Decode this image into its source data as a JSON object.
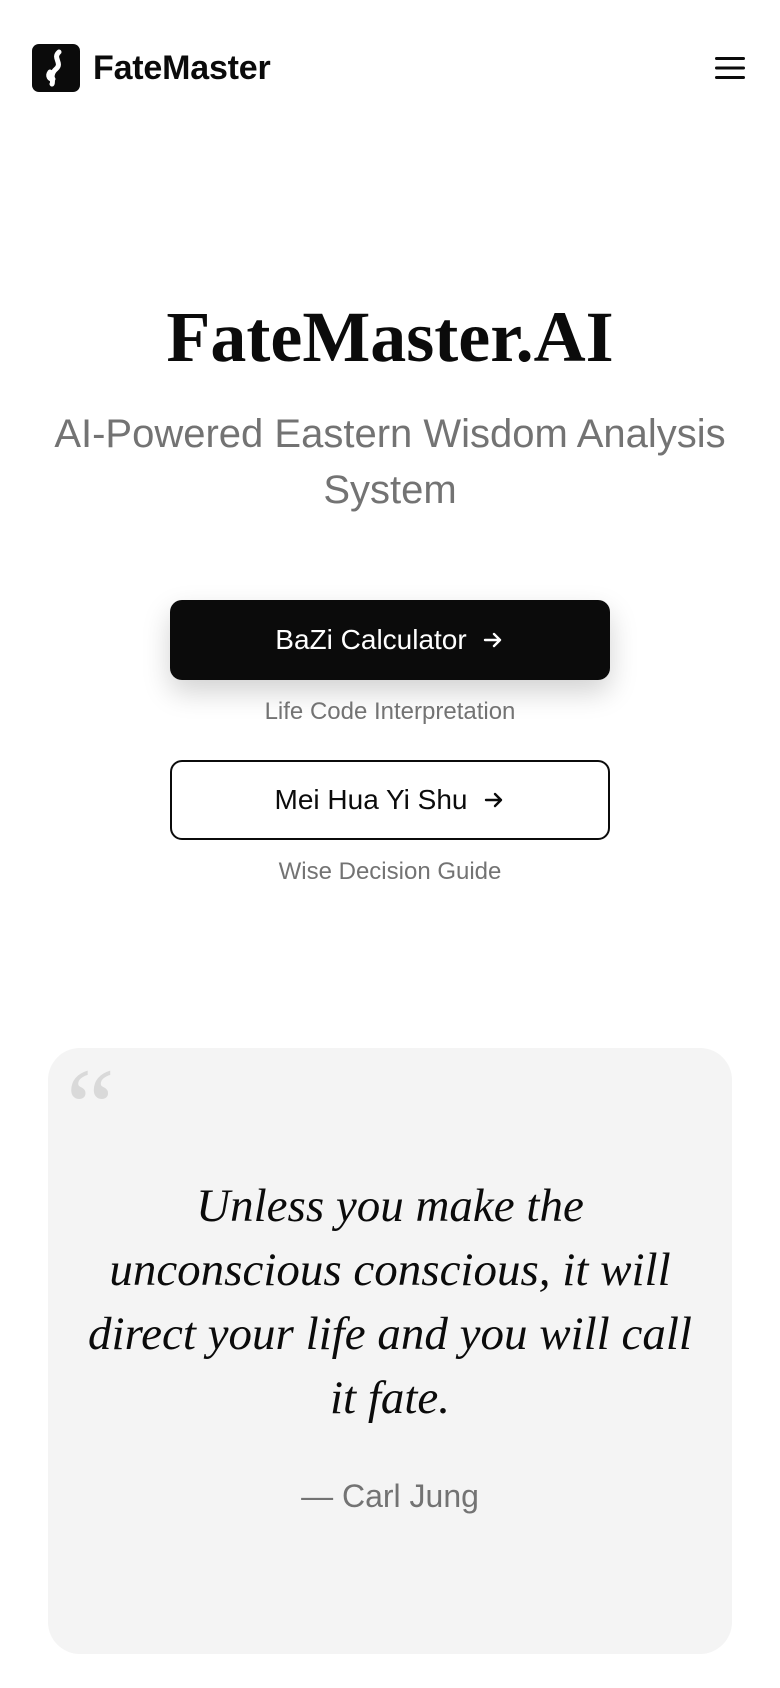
{
  "header": {
    "brand_name": "FateMaster",
    "logo_icon": "fate-logo-icon",
    "menu_icon": "hamburger-menu-icon"
  },
  "hero": {
    "title": "FateMaster.AI",
    "subtitle": "AI-Powered Eastern Wisdom Analysis System"
  },
  "actions": {
    "primary": {
      "label": "BaZi Calculator",
      "caption": "Life Code Interpretation",
      "icon": "arrow-right-icon"
    },
    "secondary": {
      "label": "Mei Hua Yi Shu",
      "caption": "Wise Decision Guide",
      "icon": "arrow-right-icon"
    }
  },
  "quote": {
    "mark": "“",
    "text": "Unless you make the unconscious conscious, it will direct your life and you will call it fate.",
    "author": "— Carl Jung"
  },
  "colors": {
    "primary": "#0b0b0b",
    "muted_text": "#737373",
    "card_background": "#f4f4f4",
    "quote_mark": "#d9d9d9"
  }
}
